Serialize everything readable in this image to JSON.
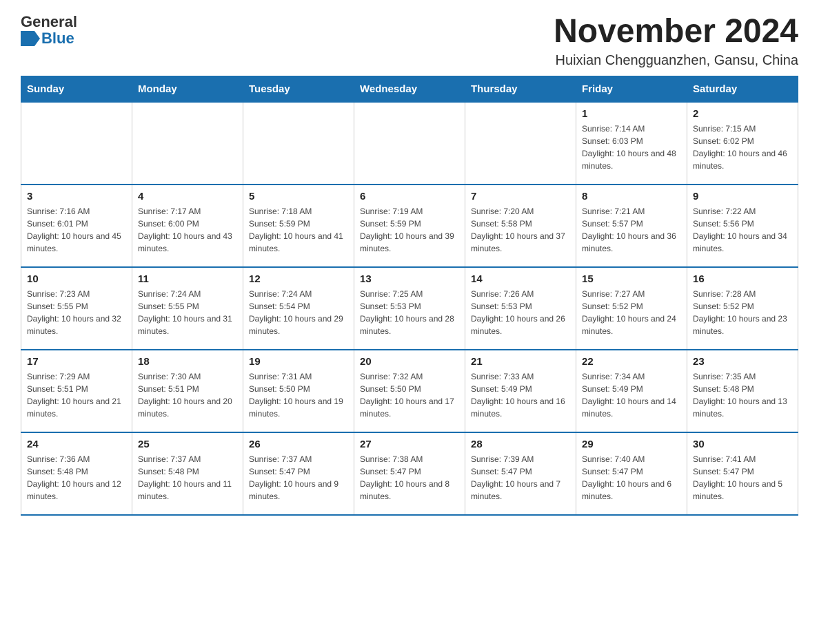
{
  "header": {
    "logo": {
      "general": "General",
      "arrow_icon": "▶",
      "blue": "Blue"
    },
    "title": "November 2024",
    "location": "Huixian Chengguanzhen, Gansu, China"
  },
  "days_of_week": [
    "Sunday",
    "Monday",
    "Tuesday",
    "Wednesday",
    "Thursday",
    "Friday",
    "Saturday"
  ],
  "weeks": [
    [
      {
        "day": "",
        "info": ""
      },
      {
        "day": "",
        "info": ""
      },
      {
        "day": "",
        "info": ""
      },
      {
        "day": "",
        "info": ""
      },
      {
        "day": "",
        "info": ""
      },
      {
        "day": "1",
        "info": "Sunrise: 7:14 AM\nSunset: 6:03 PM\nDaylight: 10 hours and 48 minutes."
      },
      {
        "day": "2",
        "info": "Sunrise: 7:15 AM\nSunset: 6:02 PM\nDaylight: 10 hours and 46 minutes."
      }
    ],
    [
      {
        "day": "3",
        "info": "Sunrise: 7:16 AM\nSunset: 6:01 PM\nDaylight: 10 hours and 45 minutes."
      },
      {
        "day": "4",
        "info": "Sunrise: 7:17 AM\nSunset: 6:00 PM\nDaylight: 10 hours and 43 minutes."
      },
      {
        "day": "5",
        "info": "Sunrise: 7:18 AM\nSunset: 5:59 PM\nDaylight: 10 hours and 41 minutes."
      },
      {
        "day": "6",
        "info": "Sunrise: 7:19 AM\nSunset: 5:59 PM\nDaylight: 10 hours and 39 minutes."
      },
      {
        "day": "7",
        "info": "Sunrise: 7:20 AM\nSunset: 5:58 PM\nDaylight: 10 hours and 37 minutes."
      },
      {
        "day": "8",
        "info": "Sunrise: 7:21 AM\nSunset: 5:57 PM\nDaylight: 10 hours and 36 minutes."
      },
      {
        "day": "9",
        "info": "Sunrise: 7:22 AM\nSunset: 5:56 PM\nDaylight: 10 hours and 34 minutes."
      }
    ],
    [
      {
        "day": "10",
        "info": "Sunrise: 7:23 AM\nSunset: 5:55 PM\nDaylight: 10 hours and 32 minutes."
      },
      {
        "day": "11",
        "info": "Sunrise: 7:24 AM\nSunset: 5:55 PM\nDaylight: 10 hours and 31 minutes."
      },
      {
        "day": "12",
        "info": "Sunrise: 7:24 AM\nSunset: 5:54 PM\nDaylight: 10 hours and 29 minutes."
      },
      {
        "day": "13",
        "info": "Sunrise: 7:25 AM\nSunset: 5:53 PM\nDaylight: 10 hours and 28 minutes."
      },
      {
        "day": "14",
        "info": "Sunrise: 7:26 AM\nSunset: 5:53 PM\nDaylight: 10 hours and 26 minutes."
      },
      {
        "day": "15",
        "info": "Sunrise: 7:27 AM\nSunset: 5:52 PM\nDaylight: 10 hours and 24 minutes."
      },
      {
        "day": "16",
        "info": "Sunrise: 7:28 AM\nSunset: 5:52 PM\nDaylight: 10 hours and 23 minutes."
      }
    ],
    [
      {
        "day": "17",
        "info": "Sunrise: 7:29 AM\nSunset: 5:51 PM\nDaylight: 10 hours and 21 minutes."
      },
      {
        "day": "18",
        "info": "Sunrise: 7:30 AM\nSunset: 5:51 PM\nDaylight: 10 hours and 20 minutes."
      },
      {
        "day": "19",
        "info": "Sunrise: 7:31 AM\nSunset: 5:50 PM\nDaylight: 10 hours and 19 minutes."
      },
      {
        "day": "20",
        "info": "Sunrise: 7:32 AM\nSunset: 5:50 PM\nDaylight: 10 hours and 17 minutes."
      },
      {
        "day": "21",
        "info": "Sunrise: 7:33 AM\nSunset: 5:49 PM\nDaylight: 10 hours and 16 minutes."
      },
      {
        "day": "22",
        "info": "Sunrise: 7:34 AM\nSunset: 5:49 PM\nDaylight: 10 hours and 14 minutes."
      },
      {
        "day": "23",
        "info": "Sunrise: 7:35 AM\nSunset: 5:48 PM\nDaylight: 10 hours and 13 minutes."
      }
    ],
    [
      {
        "day": "24",
        "info": "Sunrise: 7:36 AM\nSunset: 5:48 PM\nDaylight: 10 hours and 12 minutes."
      },
      {
        "day": "25",
        "info": "Sunrise: 7:37 AM\nSunset: 5:48 PM\nDaylight: 10 hours and 11 minutes."
      },
      {
        "day": "26",
        "info": "Sunrise: 7:37 AM\nSunset: 5:47 PM\nDaylight: 10 hours and 9 minutes."
      },
      {
        "day": "27",
        "info": "Sunrise: 7:38 AM\nSunset: 5:47 PM\nDaylight: 10 hours and 8 minutes."
      },
      {
        "day": "28",
        "info": "Sunrise: 7:39 AM\nSunset: 5:47 PM\nDaylight: 10 hours and 7 minutes."
      },
      {
        "day": "29",
        "info": "Sunrise: 7:40 AM\nSunset: 5:47 PM\nDaylight: 10 hours and 6 minutes."
      },
      {
        "day": "30",
        "info": "Sunrise: 7:41 AM\nSunset: 5:47 PM\nDaylight: 10 hours and 5 minutes."
      }
    ]
  ]
}
